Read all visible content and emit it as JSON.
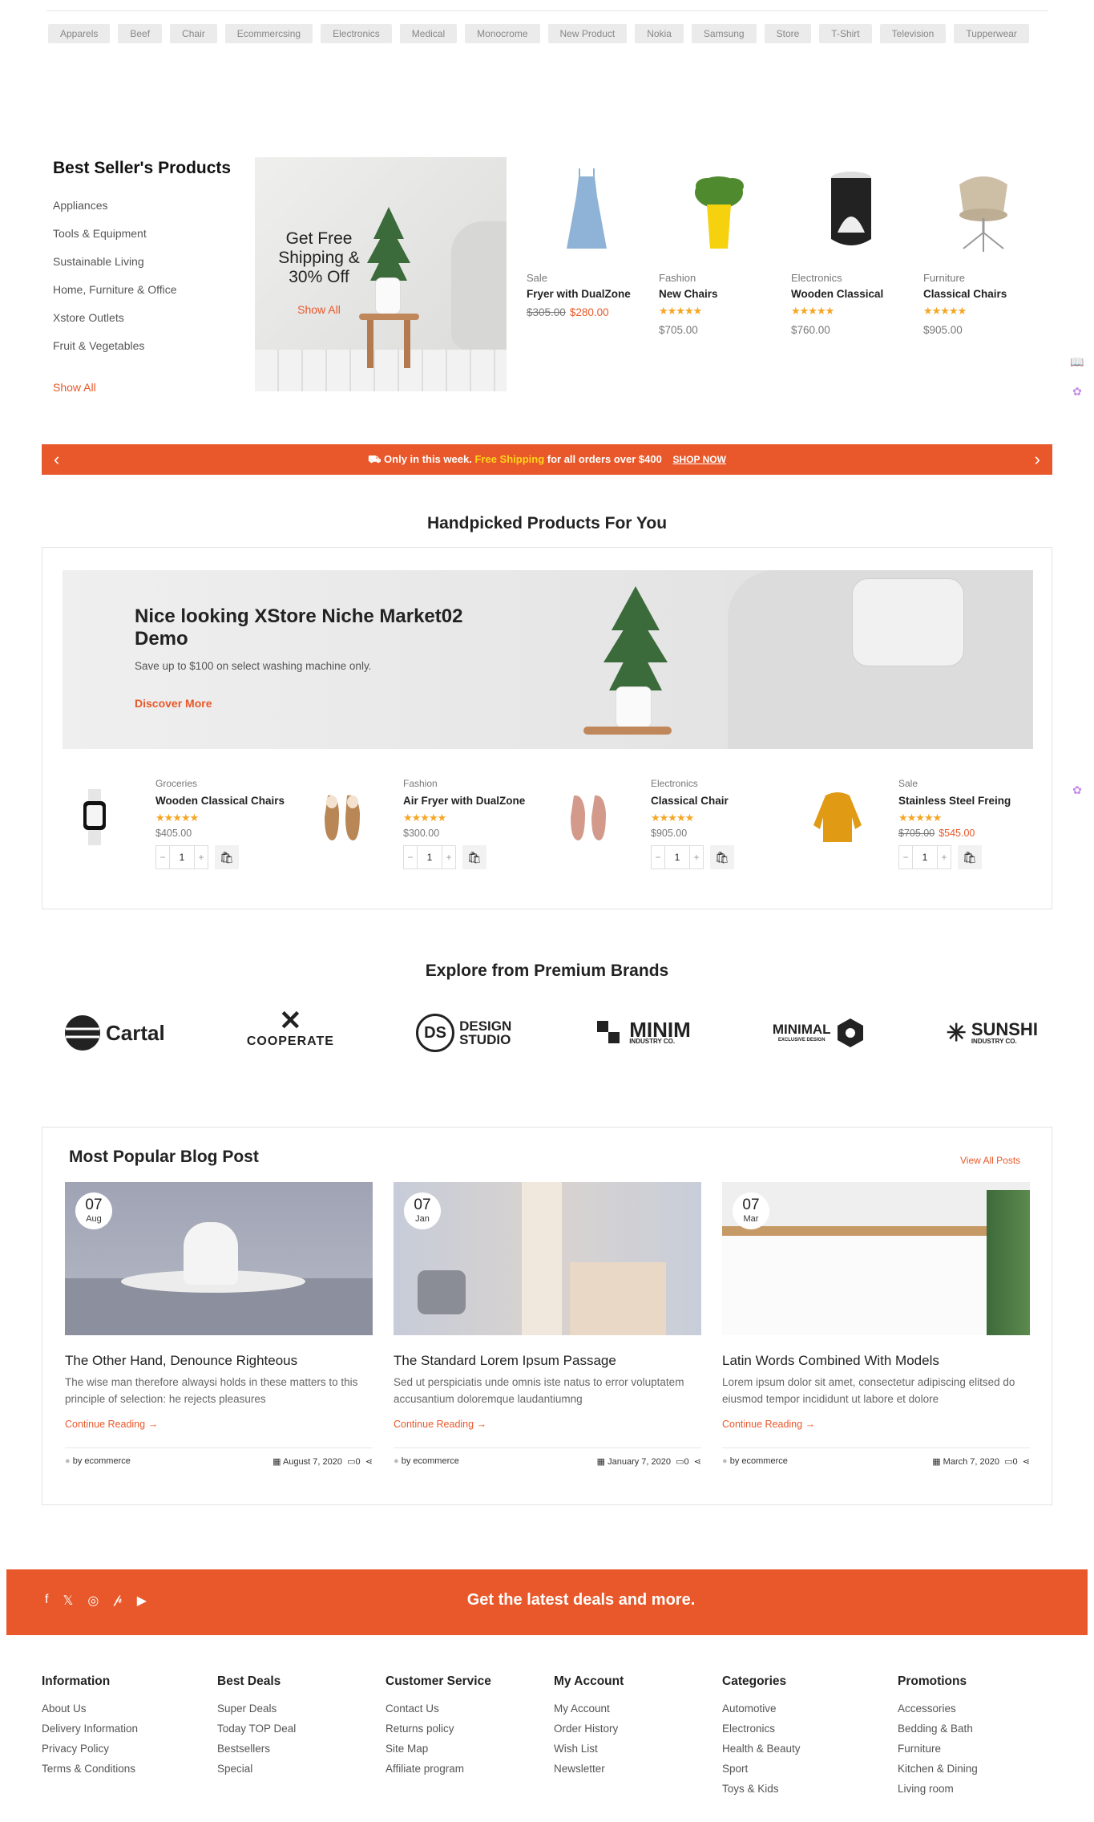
{
  "tags": [
    "Apparels",
    "Beef",
    "Chair",
    "Ecommercsing",
    "Electronics",
    "Medical",
    "Monocrome",
    "New Product",
    "Nokia",
    "Samsung",
    "Store",
    "T-Shirt",
    "Television",
    "Tupperwear"
  ],
  "best_seller": {
    "title": "Best Seller's Products",
    "categories": [
      "Appliances",
      "Tools & Equipment",
      "Sustainable Living",
      "Home, Furniture & Office",
      "Xstore Outlets",
      "Fruit & Vegetables"
    ],
    "show_all": "Show All",
    "promo": {
      "text": "Get Free Shipping & 30% Off",
      "link": "Show All"
    },
    "products": [
      {
        "category": "Sale",
        "name": "Fryer with DualZone",
        "old_price": "$305.00",
        "price": "$280.00",
        "stars": ""
      },
      {
        "category": "Fashion",
        "name": "New Chairs",
        "price": "$705.00",
        "stars": "★★★★★"
      },
      {
        "category": "Electronics",
        "name": "Wooden Classical",
        "price": "$760.00",
        "stars": "★★★★★"
      },
      {
        "category": "Furniture",
        "name": "Classical Chairs",
        "price": "$905.00",
        "stars": "★★★★★"
      }
    ]
  },
  "banner": {
    "prefix": "Only in this week.",
    "highlight": "Free Shipping",
    "suffix": "for all orders over $400",
    "cta": "SHOP NOW",
    "prev": "‹",
    "next": "›"
  },
  "handpicked": {
    "title": "Handpicked Products For You",
    "hero": {
      "title": "Nice looking XStore Niche Market02 Demo",
      "subtitle": "Save up to $100 on select washing machine only.",
      "cta": "Discover More"
    },
    "items": [
      {
        "category": "Groceries",
        "name": "Wooden Classical Chairs",
        "price": "$405.00",
        "stars": "★★★★★",
        "qty": "1"
      },
      {
        "category": "Fashion",
        "name": "Air Fryer with DualZone",
        "price": "$300.00",
        "stars": "★★★★★",
        "qty": "1"
      },
      {
        "category": "Electronics",
        "name": "Classical Chair",
        "price": "$905.00",
        "stars": "★★★★★",
        "qty": "1"
      },
      {
        "category": "Sale",
        "name": "Stainless Steel Freing",
        "old_price": "$705.00",
        "price": "$545.00",
        "stars": "★★★★★",
        "qty": "1"
      }
    ]
  },
  "brands": {
    "title": "Explore from Premium Brands",
    "items": [
      {
        "name": "Cartal"
      },
      {
        "name": "COOPERATE"
      },
      {
        "name": "DESIGN STUDIO",
        "mark": "DS"
      },
      {
        "name": "MINIM",
        "sub": "INDUSTRY CO."
      },
      {
        "name": "MINIMAL",
        "sub": "EXCLUSIVE DESIGN"
      },
      {
        "name": "SUNSHI",
        "sub": "INDUSTRY CO."
      }
    ]
  },
  "blog": {
    "title": "Most Popular Blog Post",
    "view_all": "View All Posts",
    "posts": [
      {
        "day": "07",
        "month": "Aug",
        "title": "The Other Hand, Denounce Righteous",
        "excerpt": "The wise man therefore alwaysi holds in these matters to this principle of selection: he rejects pleasures",
        "more": "Continue Reading",
        "author": "by  ecommerce",
        "date": "August 7, 2020",
        "comments": "0"
      },
      {
        "day": "07",
        "month": "Jan",
        "title": "The Standard Lorem Ipsum Passage",
        "excerpt": "Sed ut perspiciatis unde omnis iste natus to error voluptatem accusantium doloremque laudantiumng",
        "more": "Continue Reading",
        "author": "by  ecommerce",
        "date": "January 7, 2020",
        "comments": "0"
      },
      {
        "day": "07",
        "month": "Mar",
        "title": "Latin Words Combined With Models",
        "excerpt": "Lorem ipsum dolor sit amet, consectetur adipiscing elitsed do eiusmod tempor incididunt ut labore et dolore",
        "more": "Continue Reading",
        "author": "by  ecommerce",
        "date": "March 7, 2020",
        "comments": "0"
      }
    ]
  },
  "footer": {
    "deals": "Get the latest deals and more.",
    "social": [
      "f",
      "𝕏",
      "◎",
      "𝓅",
      "▶"
    ],
    "columns": [
      {
        "title": "Information",
        "links": [
          "About Us",
          "Delivery Information",
          "Privacy Policy",
          "Terms & Conditions"
        ]
      },
      {
        "title": "Best Deals",
        "links": [
          "Super Deals",
          "Today TOP Deal",
          "Bestsellers",
          "Special"
        ]
      },
      {
        "title": "Customer Service",
        "links": [
          "Contact Us",
          "Returns policy",
          "Site Map",
          "Affiliate program"
        ]
      },
      {
        "title": "My Account",
        "links": [
          "My Account",
          "Order History",
          "Wish List",
          "Newsletter"
        ]
      },
      {
        "title": "Categories",
        "links": [
          "Automotive",
          "Electronics",
          "Health & Beauty",
          "Sport",
          "Toys & Kids"
        ]
      },
      {
        "title": "Promotions",
        "links": [
          "Accessories",
          "Bedding & Bath",
          "Furniture",
          "Kitchen & Dining",
          "Living room"
        ]
      }
    ]
  },
  "colors": {
    "accent": "#e8582a",
    "star": "#f5a623",
    "highlight": "#ffd41a"
  }
}
